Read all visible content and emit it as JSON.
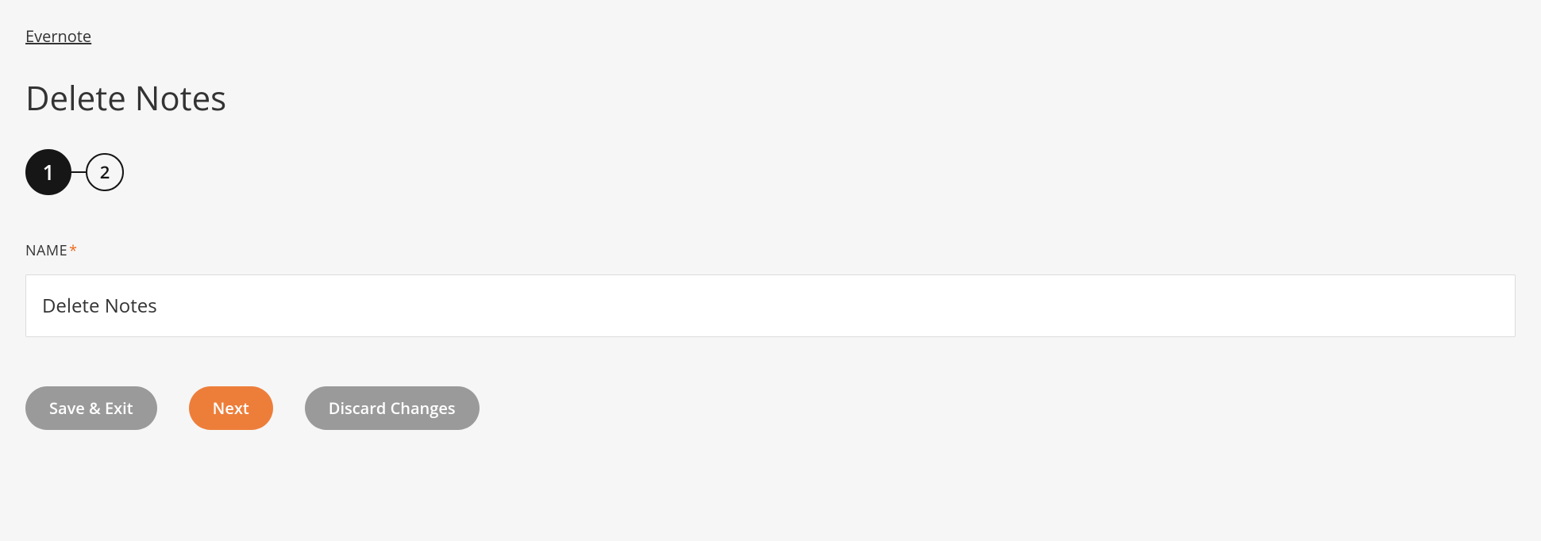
{
  "breadcrumb": {
    "label": "Evernote"
  },
  "page": {
    "title": "Delete Notes"
  },
  "stepper": {
    "steps": [
      "1",
      "2"
    ],
    "activeIndex": 0
  },
  "form": {
    "name": {
      "label": "NAME",
      "required_mark": "*",
      "value": "Delete Notes"
    }
  },
  "buttons": {
    "save_exit": "Save & Exit",
    "next": "Next",
    "discard": "Discard Changes"
  }
}
